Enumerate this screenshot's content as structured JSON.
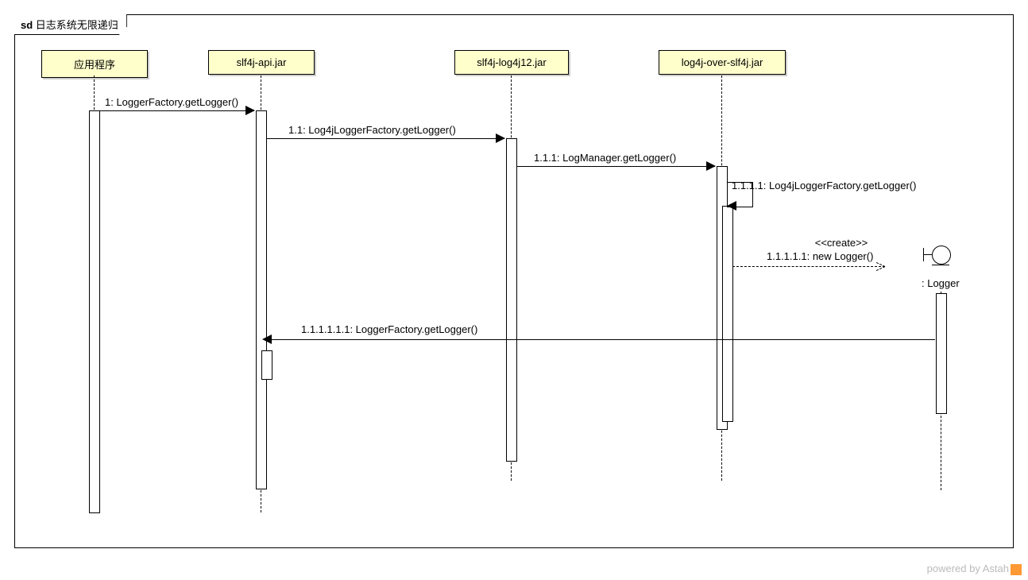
{
  "diagram": {
    "title_prefix": "sd",
    "title": "日志系统无限递归",
    "participants": {
      "p1": "应用程序",
      "p2": "slf4j-api.jar",
      "p3": "slf4j-log4j12.jar",
      "p4": "log4j-over-slf4j.jar"
    },
    "logger_label": ": Logger",
    "messages": {
      "m1": "1: LoggerFactory.getLogger()",
      "m11": "1.1: Log4jLoggerFactory.getLogger()",
      "m111": "1.1.1: LogManager.getLogger()",
      "m1111": "1.1.1.1: Log4jLoggerFactory.getLogger()",
      "create_stereo": "<<create>>",
      "m11111": "1.1.1.1.1: new Logger()",
      "m111111": "1.1.1.1.1.1: LoggerFactory.getLogger()"
    },
    "watermark": "powered by Astah"
  }
}
